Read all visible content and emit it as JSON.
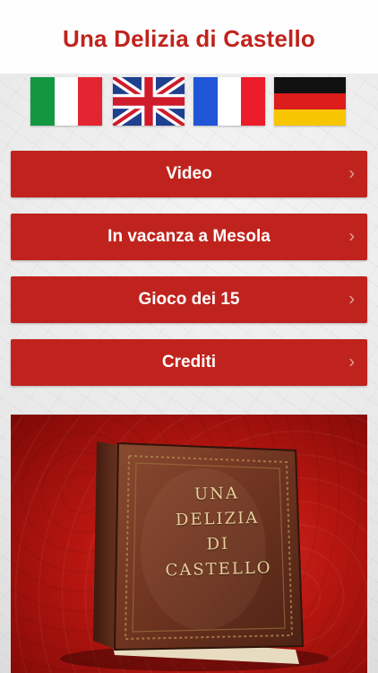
{
  "header": {
    "title": "Una Delizia di Castello"
  },
  "languages": [
    {
      "code": "it",
      "icon": "italy-flag-icon"
    },
    {
      "code": "en",
      "icon": "uk-flag-icon"
    },
    {
      "code": "fr",
      "icon": "france-flag-icon"
    },
    {
      "code": "de",
      "icon": "germany-flag-icon"
    }
  ],
  "menu": {
    "items": [
      {
        "label": "Video"
      },
      {
        "label": "In vacanza a Mesola"
      },
      {
        "label": "Gioco dei 15"
      },
      {
        "label": "Crediti"
      }
    ],
    "chevron": "›"
  },
  "book": {
    "lines": [
      "UNA",
      "DELIZIA",
      "DI",
      "CASTELLO"
    ]
  },
  "colors": {
    "accent": "#c0231d",
    "button_text": "#ffffff",
    "book_gold": "#e9cf9a"
  }
}
